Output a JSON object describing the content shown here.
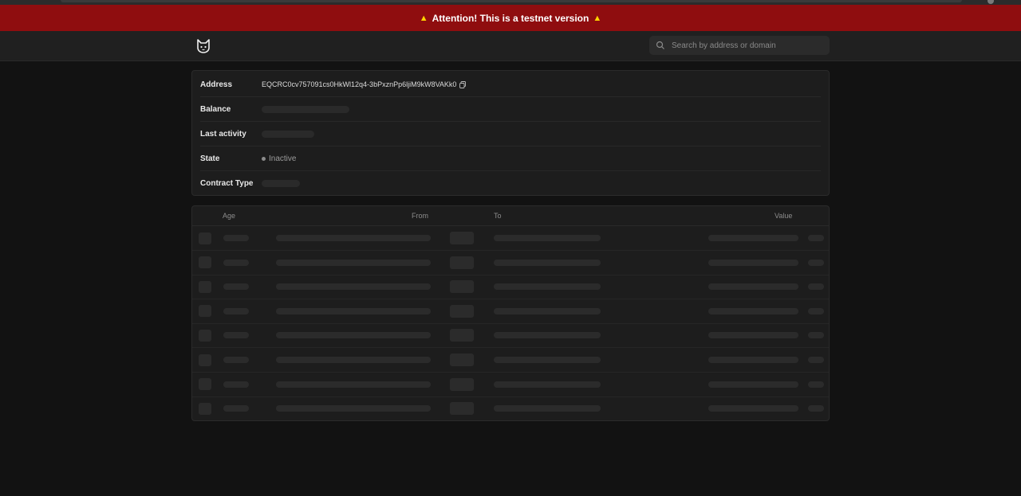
{
  "banner": {
    "text": "Attention! This is a testnet version",
    "icon": "warning-icon",
    "color": "#8f0d0f"
  },
  "header": {
    "logo": "cat-logo-icon",
    "search": {
      "placeholder": "Search by address or domain"
    }
  },
  "account": {
    "rows": [
      {
        "label": "Address",
        "value": "EQCRC0cv757091cs0HkWl12q4-3bPxznPp6ljiM9kW8VAKk0"
      },
      {
        "label": "Balance",
        "value": ""
      },
      {
        "label": "Last activity",
        "value": ""
      },
      {
        "label": "State",
        "value": "Inactive"
      },
      {
        "label": "Contract Type",
        "value": ""
      }
    ]
  },
  "transactions": {
    "columns": {
      "age": "Age",
      "from": "From",
      "to": "To",
      "value": "Value"
    },
    "loading_row_count": 8
  }
}
